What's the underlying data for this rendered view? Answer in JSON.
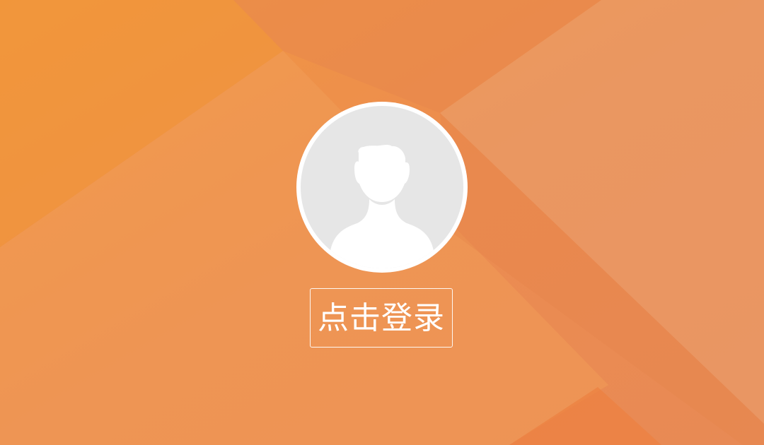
{
  "login": {
    "button_label": "点击登录"
  },
  "avatar": {
    "icon": "user-silhouette-icon"
  },
  "colors": {
    "background_primary": "#ee8f52",
    "background_light": "#f09a55",
    "avatar_fill": "#e6e6e6",
    "avatar_border": "#ffffff",
    "button_text": "#ffffff"
  }
}
